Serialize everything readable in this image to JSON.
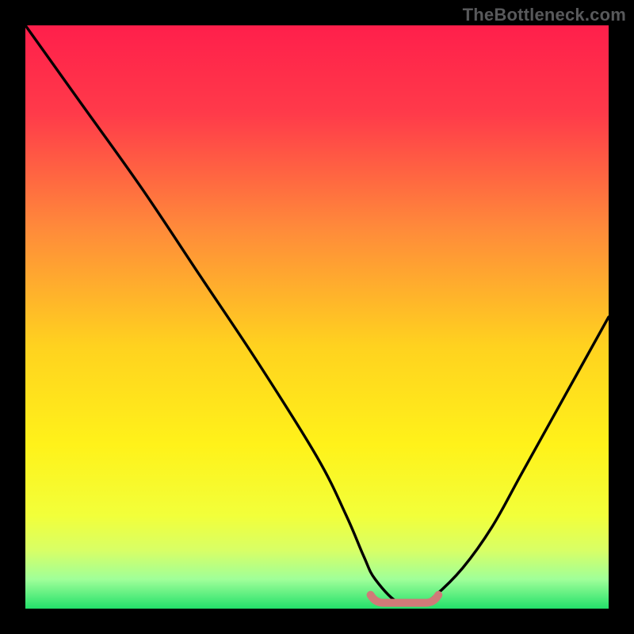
{
  "attribution": "TheBottleneck.com",
  "gradient_stops": [
    {
      "offset": "0%",
      "color": "#ff1f4b"
    },
    {
      "offset": "15%",
      "color": "#ff3a4a"
    },
    {
      "offset": "35%",
      "color": "#ff8b3a"
    },
    {
      "offset": "55%",
      "color": "#ffd21f"
    },
    {
      "offset": "72%",
      "color": "#fff21a"
    },
    {
      "offset": "84%",
      "color": "#f2ff3a"
    },
    {
      "offset": "90%",
      "color": "#d8ff66"
    },
    {
      "offset": "95%",
      "color": "#9fff99"
    },
    {
      "offset": "100%",
      "color": "#23e06a"
    }
  ],
  "marker": {
    "color": "#d07a78",
    "stroke": "#9a4b48"
  },
  "chart_data": {
    "type": "line",
    "title": "",
    "xlabel": "",
    "ylabel": "",
    "xlim": [
      0,
      100
    ],
    "ylim": [
      0,
      100
    ],
    "series": [
      {
        "name": "curve",
        "x": [
          0,
          5,
          10,
          20,
          30,
          40,
          50,
          55,
          58,
          60,
          64,
          68,
          70,
          75,
          80,
          85,
          90,
          95,
          100
        ],
        "y": [
          100,
          93,
          86,
          72,
          57,
          42,
          26,
          16,
          9,
          5,
          1,
          1,
          2,
          7,
          14,
          23,
          32,
          41,
          50
        ]
      }
    ],
    "annotations": [
      {
        "type": "flat-segment",
        "x0": 60,
        "x1": 70,
        "y": 1
      }
    ]
  }
}
